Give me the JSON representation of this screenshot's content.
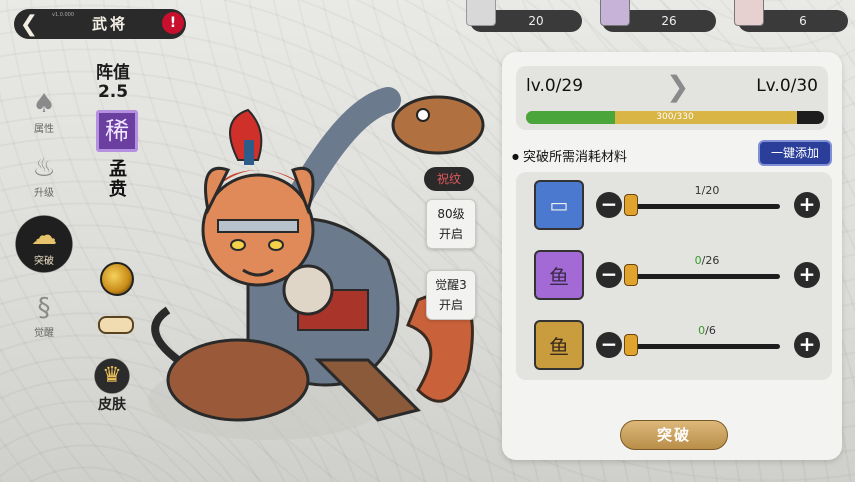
{
  "version_tag": "v1.0.000",
  "header": {
    "title": "武将",
    "alert": "!"
  },
  "resources": [
    {
      "name": "silver-plate",
      "value": "20",
      "color": "#4a79cf"
    },
    {
      "name": "purple-sack",
      "value": "26",
      "color": "#a36ad6"
    },
    {
      "name": "gold-sack",
      "value": "6",
      "color": "#c99c3e"
    }
  ],
  "side_nav": [
    {
      "label": "属性",
      "icon": "cat-head-icon",
      "active": false
    },
    {
      "label": "升级",
      "icon": "flame-icon",
      "active": false
    },
    {
      "label": "突破",
      "icon": "cloud-icon",
      "active": true
    },
    {
      "label": "觉醒",
      "icon": "dragon-icon",
      "active": false
    }
  ],
  "hero": {
    "power_label": "阵值",
    "power_value": "2.5",
    "rarity": "稀",
    "name": "孟贲",
    "skin_label": "皮肤"
  },
  "pattern_tag": "祝纹",
  "unlocks": [
    {
      "line1": "80级",
      "line2": "开启"
    },
    {
      "line1": "觉醒3",
      "line2": "开启"
    }
  ],
  "level": {
    "current": "lv.0/29",
    "next": "Lv.0/30",
    "exp_text": "300/330",
    "exp_fraction": 0.909,
    "green_fraction": 0.3
  },
  "materials": {
    "heading": "突破所需消耗材料",
    "add_all_label": "一键添加",
    "items": [
      {
        "name": "silver-plate",
        "have": "1",
        "need": "/20",
        "have_green": false,
        "rarity": "blue",
        "icon": "▭"
      },
      {
        "name": "purple-sack",
        "have": "0",
        "need": "/26",
        "have_green": true,
        "rarity": "purple",
        "icon": "鱼"
      },
      {
        "name": "gold-sack",
        "have": "0",
        "need": "/6",
        "have_green": true,
        "rarity": "gold",
        "icon": "鱼"
      }
    ]
  },
  "break_button": "突破"
}
